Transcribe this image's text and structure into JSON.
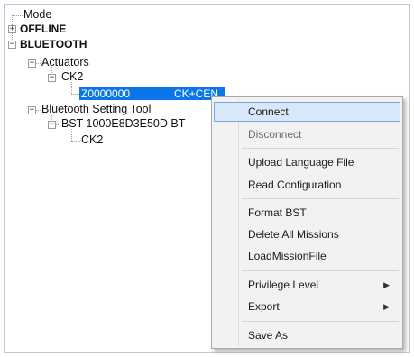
{
  "tree": {
    "root": "Mode",
    "offline": "OFFLINE",
    "bluetooth": "BLUETOOTH",
    "actuators": "Actuators",
    "ck2_group": "CK2",
    "selected_id": "Z0000000",
    "selected_type": "CK+CEN",
    "setting_tool": "Bluetooth Setting Tool",
    "bst_device": "BST 1000E8D3E50D BT",
    "bst_child": "CK2",
    "expander_collapsed": "+",
    "expander_expanded": "−"
  },
  "context_menu": {
    "items": [
      {
        "label": "Connect",
        "state": "hover"
      },
      {
        "label": "Disconnect",
        "state": "disabled"
      },
      {
        "label": "Upload Language File"
      },
      {
        "label": "Read Configuration"
      },
      {
        "label": "Format BST"
      },
      {
        "label": "Delete All Missions"
      },
      {
        "label": "LoadMissionFile"
      },
      {
        "label": "Privilege Level",
        "submenu": true
      },
      {
        "label": "Export",
        "submenu": true
      },
      {
        "label": "Save As"
      }
    ],
    "submenu_arrow": "▶"
  },
  "colors": {
    "selection": "#0a76e8",
    "menu_background": "#f2f2f2",
    "menu_hover": "#d8e8f8",
    "menu_hover_border": "#74a9e0"
  }
}
